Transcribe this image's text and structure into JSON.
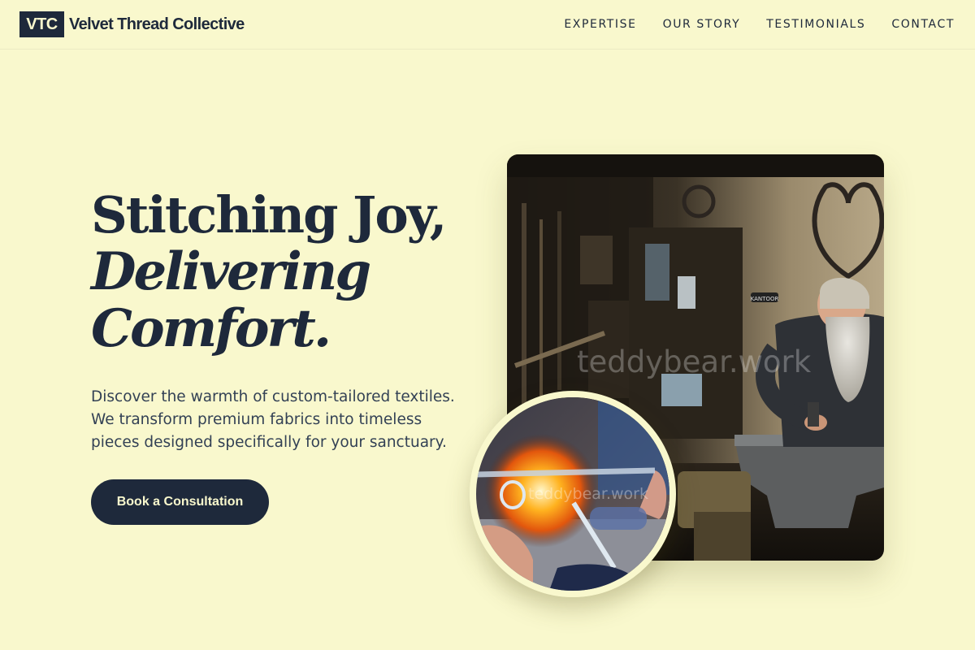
{
  "header": {
    "logo_text": "VTC",
    "brand_name": "Velvet Thread Collective",
    "nav": [
      {
        "label": "EXPERTISE"
      },
      {
        "label": "OUR STORY"
      },
      {
        "label": "TESTIMONIALS"
      },
      {
        "label": "CONTACT"
      }
    ]
  },
  "hero": {
    "title_line1": "Stitching Joy,",
    "title_line2": "Delivering",
    "title_line3": "Comfort.",
    "description": "Discover the warmth of custom-tailored textiles. We transform premium fabrics into timeless pieces designed specifically for your sanctuary.",
    "cta_label": "Book a Consultation"
  },
  "images": {
    "main_watermark": "teddybear.work",
    "circle_watermark": "teddybear.work",
    "workshop_sign": "KANTOOR"
  },
  "colors": {
    "background": "#f9f8cd",
    "primary": "#1e293b",
    "body_text": "#334155"
  }
}
